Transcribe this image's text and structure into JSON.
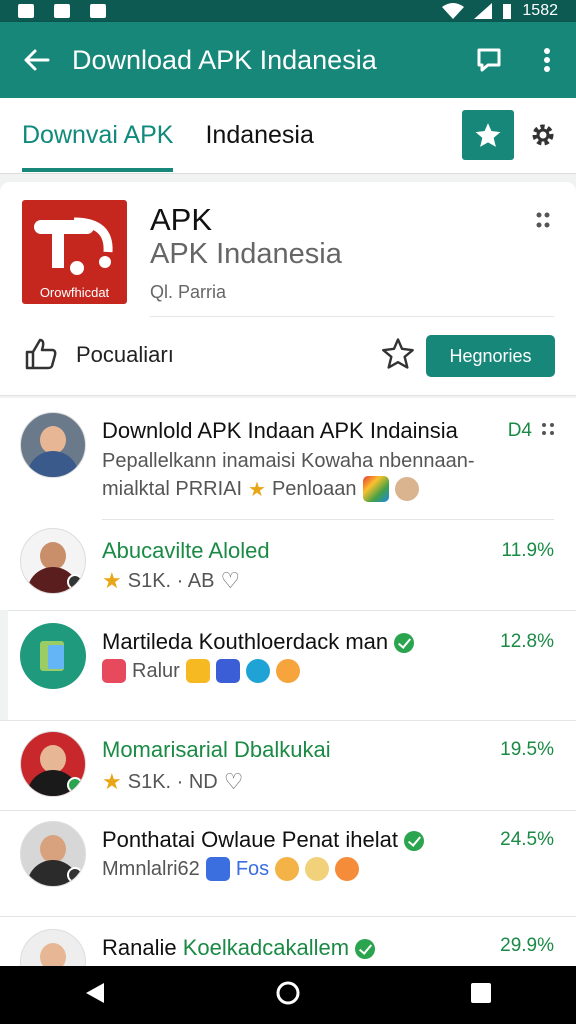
{
  "status": {
    "time": "1582"
  },
  "appbar": {
    "title": "Download APK Indanesia"
  },
  "tabs": [
    {
      "label": "Downvai APK"
    },
    {
      "label": "Indanesia"
    }
  ],
  "card": {
    "icon_caption": "Orowfhicdat",
    "app_name": "APK",
    "app_subtitle": "APK Indanesia",
    "meta": "Ql. Parria",
    "popular_label": "Pocualiarı",
    "action_button": "Hegnories"
  },
  "items": [
    {
      "title": "Downlold APK Indaan APK Indainsia",
      "sub1": "Pepallelkann inamaisi Kowaha nbennaan-",
      "sub2": "mialktal PRRIAI",
      "sub2b": "Penloaan",
      "pct": "D4"
    },
    {
      "title": "Abucavilte Aloled",
      "rating": "S1K. · AB",
      "pct": "11.9%"
    },
    {
      "title": "Martileda Kouthloerdack man",
      "tag": "Ralur",
      "pct": "12.8%"
    },
    {
      "title": "Momarisarial Dbalkukai",
      "rating": "S1K. · ND",
      "pct": "19.5%"
    },
    {
      "title": "Ponthatai Owlaue Penat ihelat",
      "tag": "Mmnlalri62",
      "tag2": "Fos",
      "pct": "24.5%"
    },
    {
      "title_a": "Ranalie",
      "title_b": "Koelkadcakallem",
      "pct": "29.9%"
    }
  ],
  "colors": {
    "primary": "#168779",
    "primary_dark": "#0d5a52",
    "accent_green": "#1a8a45",
    "icon_red": "#c5271e"
  }
}
